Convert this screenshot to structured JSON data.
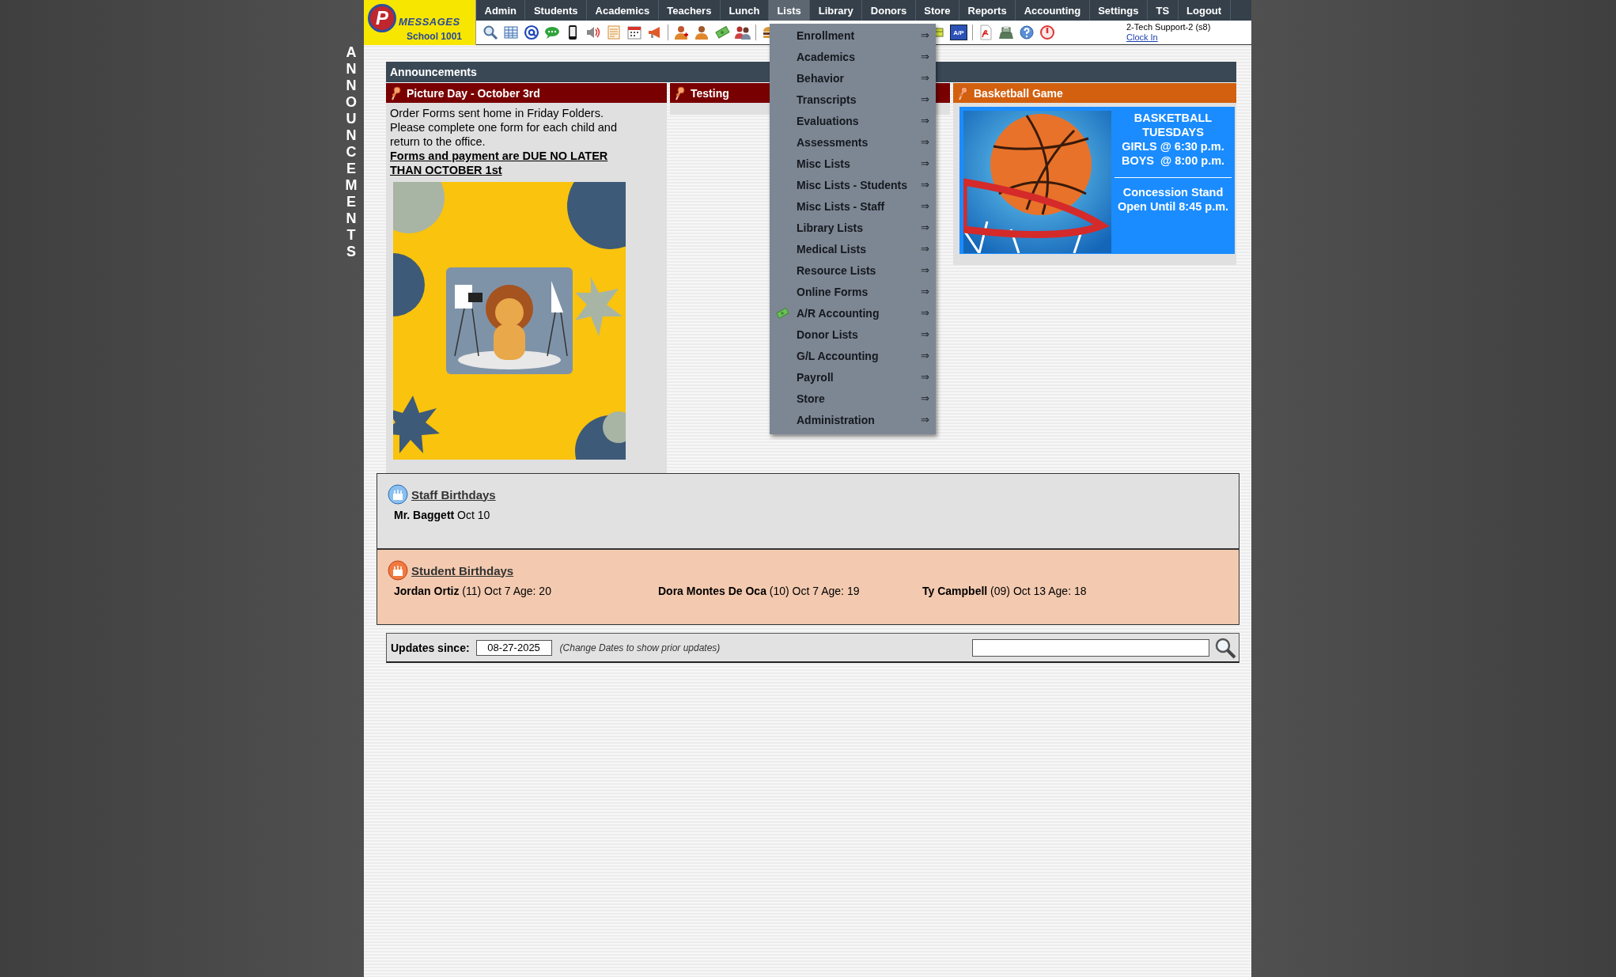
{
  "side_label": "ANNOUNCEMENTS",
  "logo": {
    "mark": "P",
    "title": "MESSAGES",
    "subtitle": "School 1001"
  },
  "nav": [
    {
      "label": "Admin",
      "selected": false
    },
    {
      "label": "Students",
      "selected": false
    },
    {
      "label": "Academics",
      "selected": false
    },
    {
      "label": "Teachers",
      "selected": false
    },
    {
      "label": "Lunch",
      "selected": false
    },
    {
      "label": "Lists",
      "selected": true
    },
    {
      "label": "Library",
      "selected": false
    },
    {
      "label": "Donors",
      "selected": false
    },
    {
      "label": "Store",
      "selected": false
    },
    {
      "label": "Reports",
      "selected": false
    },
    {
      "label": "Accounting",
      "selected": false
    },
    {
      "label": "Settings",
      "selected": false
    },
    {
      "label": "TS",
      "selected": false
    },
    {
      "label": "Logout",
      "selected": false
    }
  ],
  "toolbar": {
    "ap_label": "A/P",
    "user": "2-Tech Support-2 (s8)",
    "clock_in": "Clock In"
  },
  "lists_menu": [
    {
      "label": "Enrollment",
      "arrow": "⇒",
      "has_icon": false
    },
    {
      "label": "Academics",
      "arrow": "⇒",
      "has_icon": false
    },
    {
      "label": "Behavior",
      "arrow": "⇒",
      "has_icon": false
    },
    {
      "label": "Transcripts",
      "arrow": "⇒",
      "has_icon": false
    },
    {
      "label": "Evaluations",
      "arrow": "⇒",
      "has_icon": false
    },
    {
      "label": "Assessments",
      "arrow": "⇒",
      "has_icon": false
    },
    {
      "label": "Misc Lists",
      "arrow": "⇒",
      "has_icon": false
    },
    {
      "label": "Misc Lists - Students",
      "arrow": "⇒",
      "has_icon": false
    },
    {
      "label": "Misc Lists - Staff",
      "arrow": "⇒",
      "has_icon": false
    },
    {
      "label": "Library Lists",
      "arrow": "⇒",
      "has_icon": false
    },
    {
      "label": "Medical Lists",
      "arrow": "⇒",
      "has_icon": false
    },
    {
      "label": "Resource Lists",
      "arrow": "⇒",
      "has_icon": false
    },
    {
      "label": "Online Forms",
      "arrow": "⇒",
      "has_icon": false
    },
    {
      "label": "A/R Accounting",
      "arrow": "⇒",
      "has_icon": true
    },
    {
      "label": "Donor Lists",
      "arrow": "⇒",
      "has_icon": false
    },
    {
      "label": "G/L Accounting",
      "arrow": "⇒",
      "has_icon": false
    },
    {
      "label": "Payroll",
      "arrow": "⇒",
      "has_icon": false
    },
    {
      "label": "Store",
      "arrow": "⇒",
      "has_icon": false
    },
    {
      "label": "Administration",
      "arrow": "⇒",
      "has_icon": false
    }
  ],
  "announcements": {
    "title": "Announcements",
    "columns": [
      {
        "kind": "notice",
        "title": "Picture Day - October 3rd",
        "color": "#790000",
        "paragraphs": [
          "Order Forms sent home in Friday Folders.",
          "Please complete one form for each child and return to the office."
        ],
        "emphasis": "Forms and payment are DUE NO LATER THAN OCTOBER 1st"
      },
      {
        "kind": "empty",
        "title": "Testing",
        "color": "#790000"
      },
      {
        "kind": "promo",
        "title": "Basketball Game",
        "color": "#d2600f",
        "lines": [
          "BASKETBALL",
          "TUESDAYS",
          "GIRLS @ 6:30 p.m.",
          "BOYS  @ 8:00 p.m."
        ],
        "footer_lines": [
          "Concession Stand",
          "Open Until 8:45 p.m."
        ]
      }
    ]
  },
  "staff_birthdays": {
    "title": "Staff Birthdays",
    "entries": [
      "**Mr. Baggett** Oct 10"
    ]
  },
  "student_birthdays": {
    "title": "Student Birthdays",
    "entries": [
      "**Jordan Ortiz** (11) Oct 7 Age: 20",
      "**Dora Montes De Oca** (10) Oct 7 Age: 19",
      "**Ty Campbell** (09) Oct 13 Age: 18"
    ]
  },
  "updates": {
    "label": "Updates since:",
    "date": "08-27-2025",
    "hint": "(Change Dates to show prior updates)"
  }
}
